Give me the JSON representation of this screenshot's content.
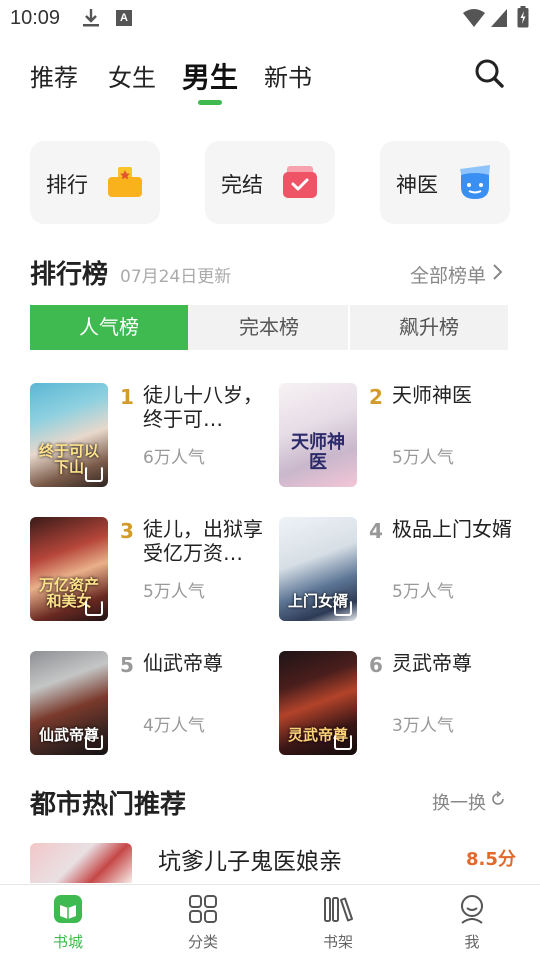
{
  "status_bar": {
    "time": "10:09",
    "a_icon_letter": "A"
  },
  "top_tabs": [
    {
      "label": "推荐",
      "active": false
    },
    {
      "label": "女生",
      "active": false
    },
    {
      "label": "男生",
      "active": true
    },
    {
      "label": "新书",
      "active": false
    }
  ],
  "entries": [
    {
      "label": "排行",
      "icon": "ranking-icon"
    },
    {
      "label": "完结",
      "icon": "finished-icon"
    },
    {
      "label": "神医",
      "icon": "doctor-icon"
    }
  ],
  "ranking": {
    "title": "排行榜",
    "updated": "07月24日更新",
    "all_label": "全部榜单",
    "segments": [
      "人气榜",
      "完本榜",
      "飙升榜"
    ],
    "active_segment": "人气榜",
    "books": [
      {
        "rank": "1",
        "title": "徒儿十八岁，终于可…",
        "popularity": "6万人气",
        "cover_text": "终于可以下山",
        "rank_color": "#d39c2a"
      },
      {
        "rank": "2",
        "title": "天师神医",
        "popularity": "5万人气",
        "cover_text": "天师神医",
        "rank_color": "#d39c2a"
      },
      {
        "rank": "3",
        "title": "徒儿，出狱享受亿万资…",
        "popularity": "5万人气",
        "cover_text": "万亿资产和美女",
        "rank_color": "#d39c2a"
      },
      {
        "rank": "4",
        "title": "极品上门女婿",
        "popularity": "5万人气",
        "cover_text": "上门女婿",
        "rank_color": "#999999"
      },
      {
        "rank": "5",
        "title": "仙武帝尊",
        "popularity": "4万人气",
        "cover_text": "仙武帝尊",
        "rank_color": "#999999"
      },
      {
        "rank": "6",
        "title": "灵武帝尊",
        "popularity": "3万人气",
        "cover_text": "灵武帝尊",
        "rank_color": "#999999"
      }
    ]
  },
  "city": {
    "title": "都市热门推荐",
    "swap_label": "换一换",
    "first_book": {
      "title": "坑爹儿子鬼医娘亲",
      "score": "8.5分"
    }
  },
  "bottom_nav": [
    {
      "label": "书城",
      "icon": "bookstore-icon",
      "active": true
    },
    {
      "label": "分类",
      "icon": "category-icon",
      "active": false
    },
    {
      "label": "书架",
      "icon": "bookshelf-icon",
      "active": false
    },
    {
      "label": "我",
      "icon": "profile-icon",
      "active": false
    }
  ],
  "colors": {
    "accent": "#3fba51",
    "score": "#e06a2a",
    "gold_rank": "#d39c2a"
  }
}
